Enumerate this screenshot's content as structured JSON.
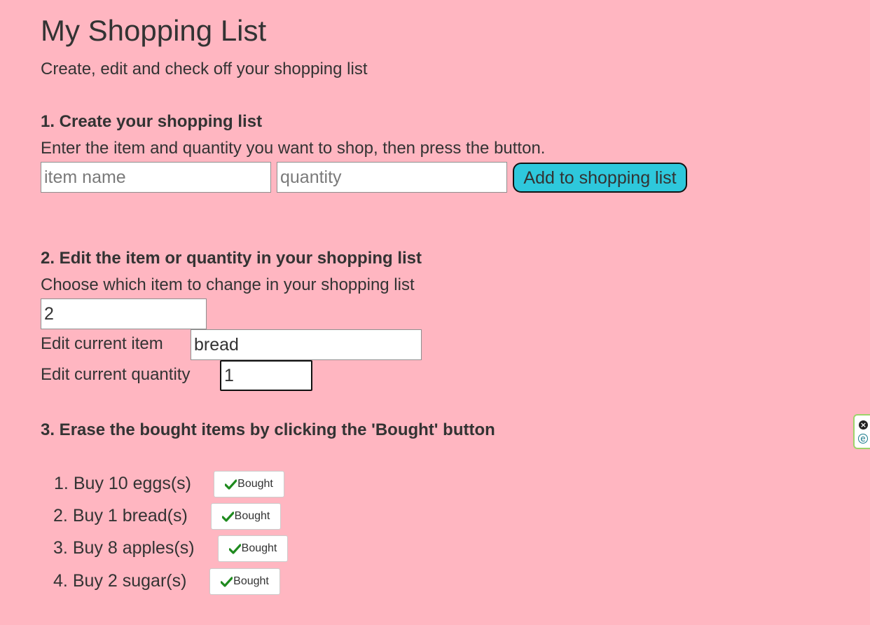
{
  "header": {
    "title": "My Shopping List",
    "subtitle": "Create, edit and check off your shopping list"
  },
  "section_create": {
    "heading": "1. Create your shopping list",
    "instructions": "Enter the item and quantity you want to shop, then press the button.",
    "item_input": {
      "value": "",
      "placeholder": "item name"
    },
    "quantity_input": {
      "value": "",
      "placeholder": "quantity"
    },
    "add_button_label": "Add to shopping list"
  },
  "section_edit": {
    "heading": "2. Edit the item or quantity in your shopping list",
    "instructions": "Choose which item to change in your shopping list",
    "index_input": {
      "value": "2"
    },
    "item_label": "Edit current item",
    "item_input": {
      "value": "bread"
    },
    "quantity_label": "Edit current quantity",
    "quantity_input": {
      "value": "1"
    }
  },
  "section_erase": {
    "heading": "3. Erase the bought items by clicking the 'Bought' button",
    "items": [
      {
        "number": "1.",
        "text": "Buy 10 eggs(s)",
        "button_label": "Bought"
      },
      {
        "number": "2.",
        "text": "Buy 1 bread(s)",
        "button_label": "Bought"
      },
      {
        "number": "3.",
        "text": "Buy 8 apples(s)",
        "button_label": "Bought"
      },
      {
        "number": "4.",
        "text": "Buy 2 sugar(s)",
        "button_label": "Bought"
      }
    ]
  },
  "side_widget": {
    "close_icon": "close-circle-icon",
    "extension_icon": "e-circle-icon",
    "close_glyph": "×",
    "extension_glyph": "e"
  },
  "colors": {
    "background": "#ffb6c1",
    "text": "#333333",
    "add_button": "#2ec8dc",
    "check": "#1e8a1e"
  }
}
